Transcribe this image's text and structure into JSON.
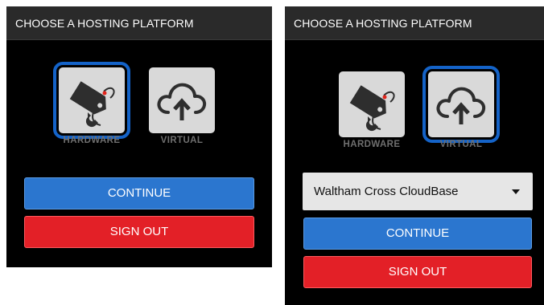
{
  "left_panel": {
    "header": "CHOOSE A HOSTING PLATFORM",
    "options": [
      {
        "label": "HARDWARE",
        "icon": "hardware-tag-icon",
        "selected": true
      },
      {
        "label": "VIRTUAL",
        "icon": "cloud-upload-icon",
        "selected": false
      }
    ],
    "continue_label": "CONTINUE",
    "signout_label": "SIGN OUT"
  },
  "right_panel": {
    "header": "CHOOSE A HOSTING PLATFORM",
    "options": [
      {
        "label": "HARDWARE",
        "icon": "hardware-tag-icon",
        "selected": false
      },
      {
        "label": "VIRTUAL",
        "icon": "cloud-upload-icon",
        "selected": true
      }
    ],
    "location_select": {
      "value": "Waltham Cross CloudBase"
    },
    "continue_label": "CONTINUE",
    "signout_label": "SIGN OUT"
  },
  "colors": {
    "selection_ring": "#1463c8",
    "continue": "#2b76cf",
    "signout": "#e32027",
    "header_bg": "#2a2a2a",
    "panel_bg": "#000000"
  }
}
